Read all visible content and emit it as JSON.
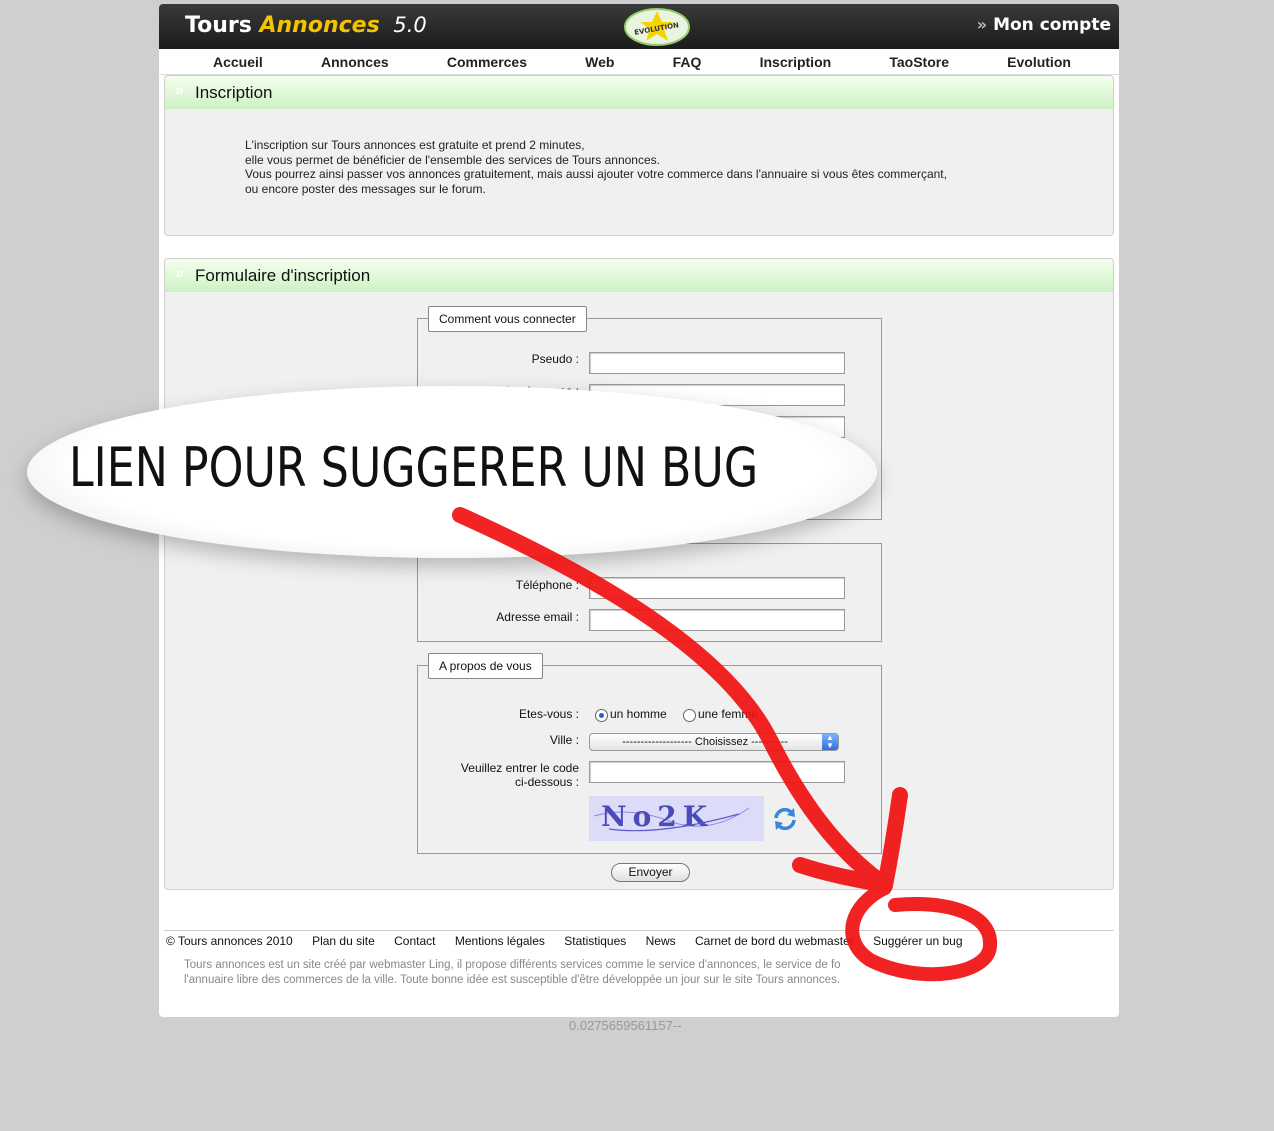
{
  "header": {
    "logo_tours": "Tours",
    "logo_annonces": "Annonces",
    "logo_version": "5.0",
    "badge_text": "EVOLUTION",
    "account_label": "Mon compte"
  },
  "nav": [
    "Accueil",
    "Annonces",
    "Commerces",
    "Web",
    "FAQ",
    "Inscription",
    "TaoStore",
    "Evolution"
  ],
  "inscription": {
    "title": "Inscription",
    "lines": [
      "L'inscription sur Tours annonces est gratuite et prend 2 minutes,",
      "elle vous permet de bénéficier de l'ensemble des services de Tours annonces.",
      "Vous pourrez ainsi passer vos annonces gratuitement, mais aussi ajouter votre commerce dans l'annuaire si vous êtes commerçant,",
      "ou encore poster des messages sur le forum."
    ]
  },
  "form": {
    "title": "Formulaire d'inscription",
    "connect_legend": "Comment vous connecter",
    "pseudo_label": "Pseudo :",
    "password_label": "Mot de passe :",
    "phone_label": "Téléphone :",
    "email_label": "Adresse email :",
    "about_legend": "A propos de vous",
    "gender_label": "Etes-vous :",
    "gender_male": "un homme",
    "gender_female": "une femme",
    "city_label": "Ville :",
    "city_selected": "------------------- Choisissez ----------",
    "code_label_1": "Veuillez entrer le code",
    "code_label_2": "ci-dessous :",
    "captcha_text": "No2K",
    "submit_label": "Envoyer"
  },
  "footer": {
    "links": [
      "© Tours annonces 2010",
      "Plan du site",
      "Contact",
      "Mentions légales",
      "Statistiques",
      "News",
      "Carnet de bord du webmaster",
      "Suggérer un bug"
    ],
    "text_line1": "Tours annonces est un site créé par webmaster Ling, il propose différents services comme le service d'annonces, le service de fo",
    "text_line2": "l'annuaire libre des commerces de la ville. Toute bonne idée est susceptible d'être développée un jour sur le site Tours annonces."
  },
  "timing": "0.0275659561157--",
  "annotation": {
    "bubble_text": "LIEN POUR SUGGERER UN BUG",
    "arrow_color": "#f01010"
  }
}
